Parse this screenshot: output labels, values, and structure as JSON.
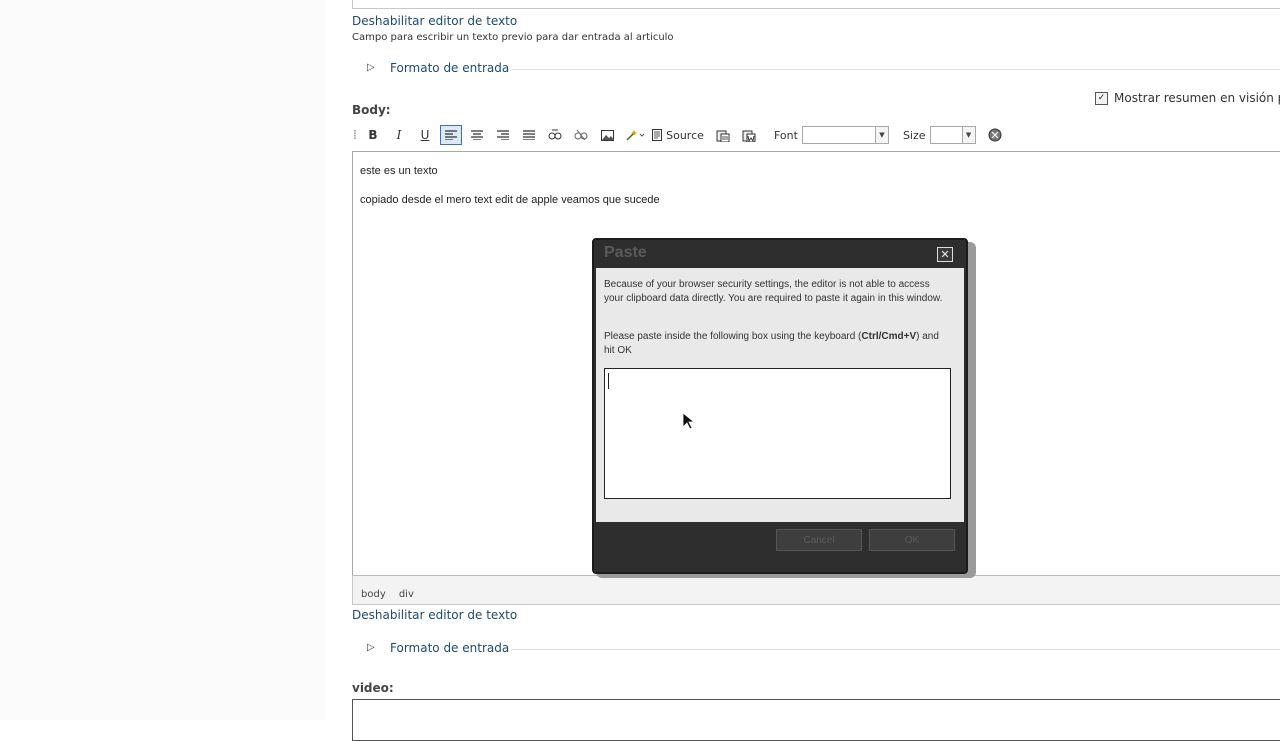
{
  "top_field": {
    "disable_editor_link": "Deshabilitar editor de texto",
    "description": "Campo para escribir un texto previo para dar entrada al articulo",
    "input_format_label": "Formato de entrada"
  },
  "summary": {
    "checkbox_label": "Mostrar resumen en visión p",
    "checked": true
  },
  "body_field": {
    "label": "Body:",
    "toolbar": {
      "bold": "B",
      "italic": "I",
      "underline": "U",
      "source_label": "Source",
      "font_label": "Font",
      "font_value": "",
      "size_label": "Size",
      "size_value": ""
    },
    "content": [
      "este es un texto",
      "copiado desde el mero text edit de apple veamos que sucede"
    ],
    "path": [
      "body",
      "div"
    ],
    "disable_editor_link": "Deshabilitar editor de texto",
    "input_format_label": "Formato de entrada"
  },
  "video_field": {
    "label": "video:"
  },
  "dialog": {
    "title": "Paste",
    "intro": "Because of your browser security settings, the editor is not able to access your clipboard data directly. You are required to paste it again in this window.",
    "instruction_prefix": "Please paste inside the following box using the keyboard (",
    "instruction_keys": "Ctrl/Cmd+V",
    "instruction_suffix": ") and hit OK",
    "textarea_value": "",
    "cancel_label": "Cancel",
    "ok_label": "OK"
  },
  "colors": {
    "link": "#1e4a6d",
    "dialog_frame": "#2e2e2e",
    "dialog_body": "#e9e9e9",
    "active_button": "#dde8f8"
  }
}
